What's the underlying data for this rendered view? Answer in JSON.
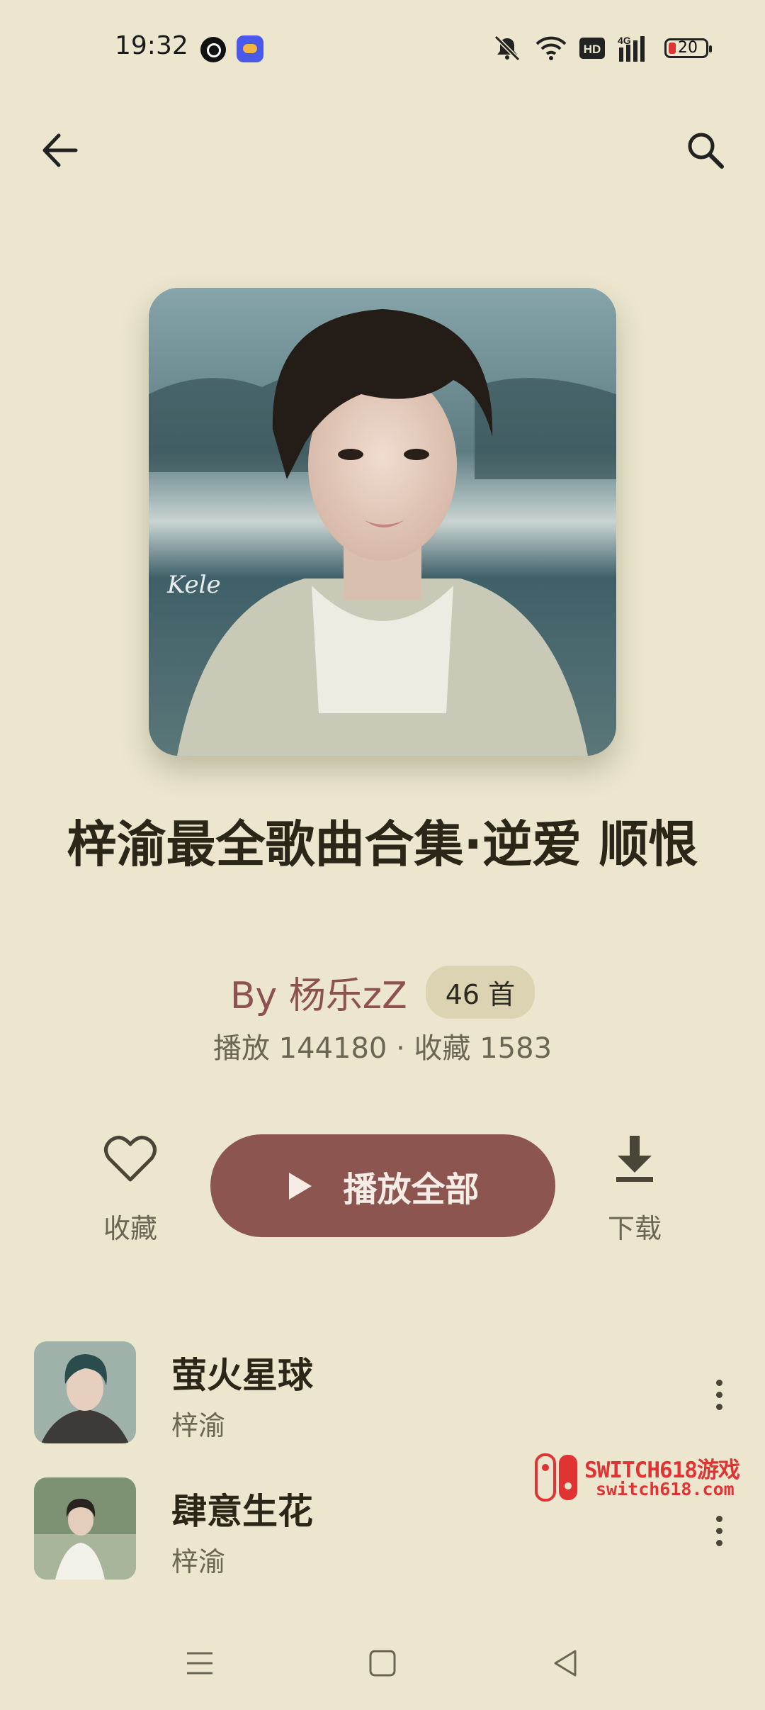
{
  "status_bar": {
    "time": "19:32",
    "battery_level": "20",
    "icons": [
      "link-icon",
      "weather-app-icon",
      "mute-icon",
      "wifi-icon",
      "hd-icon",
      "signal-4g-icon",
      "battery-icon"
    ]
  },
  "header": {
    "back_icon": "arrow-left-icon",
    "search_icon": "search-icon"
  },
  "playlist": {
    "title": "梓渝最全歌曲合集·逆爱 顺恨",
    "author": "By 杨乐zZ",
    "song_count": "46 首",
    "stats": "播放 144180 · 收藏 1583",
    "cover_signature": "Kele"
  },
  "actions": {
    "favorite_label": "收藏",
    "play_all_label": "播放全部",
    "download_label": "下载"
  },
  "songs": [
    {
      "title": "萤火星球",
      "artist": "梓渝"
    },
    {
      "title": "肆意生花",
      "artist": "梓渝"
    }
  ],
  "watermark": {
    "line1": "SWITCH618游戏",
    "line2": "switch618.com"
  },
  "colors": {
    "background": "#ebe6cd",
    "accent": "#8c5550",
    "author": "#8d514f"
  }
}
